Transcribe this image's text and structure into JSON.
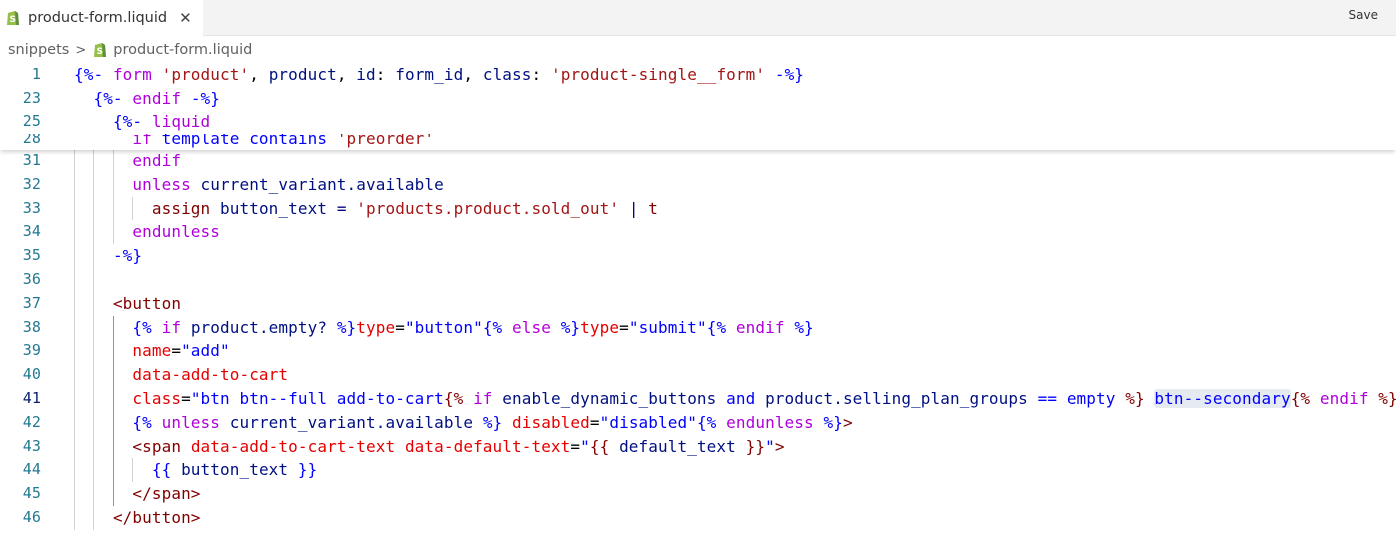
{
  "tab": {
    "title": "product-form.liquid",
    "close_icon": "close-icon",
    "file_icon": "shopify-icon"
  },
  "toolbar": {
    "save_label": "Save"
  },
  "breadcrumb": {
    "folder": "snippets",
    "file": "product-form.liquid"
  },
  "colors": {
    "brand_icon": "#95bf47",
    "line_number": "#237893",
    "selection_highlight": "#e5ebf1"
  },
  "editor": {
    "current_line": "41",
    "sticky": [
      {
        "num": "1",
        "tokens": [
          [
            "d",
            "{%-"
          ],
          [
            "p",
            " "
          ],
          [
            "k",
            "form"
          ],
          [
            "p",
            " "
          ],
          [
            "s",
            "'product'"
          ],
          [
            "p",
            ", "
          ],
          [
            "v",
            "product"
          ],
          [
            "p",
            ", "
          ],
          [
            "v",
            "id"
          ],
          [
            "p",
            ": "
          ],
          [
            "v",
            "form_id"
          ],
          [
            "p",
            ", "
          ],
          [
            "v",
            "class"
          ],
          [
            "p",
            ": "
          ],
          [
            "s",
            "'product-single__form'"
          ],
          [
            "p",
            " "
          ],
          [
            "d",
            "-%}"
          ]
        ]
      },
      {
        "num": "23",
        "tokens": [
          [
            "p",
            "  "
          ],
          [
            "d",
            "{%-"
          ],
          [
            "p",
            " "
          ],
          [
            "k",
            "endif"
          ],
          [
            "p",
            " "
          ],
          [
            "d",
            "-%}"
          ]
        ]
      },
      {
        "num": "25",
        "tokens": [
          [
            "p",
            "    "
          ],
          [
            "d",
            "{%-"
          ],
          [
            "p",
            " "
          ],
          [
            "k",
            "liquid"
          ]
        ]
      },
      {
        "num": "28",
        "tokens": [
          [
            "p",
            "      "
          ],
          [
            "k",
            "if"
          ],
          [
            "p",
            " "
          ],
          [
            "d",
            "template contains"
          ],
          [
            "p",
            " "
          ],
          [
            "s",
            "'preorder'"
          ]
        ]
      }
    ],
    "lines": [
      {
        "num": "31",
        "tokens": [
          [
            "p",
            "      "
          ],
          [
            "k",
            "endif"
          ]
        ]
      },
      {
        "num": "32",
        "tokens": [
          [
            "p",
            "      "
          ],
          [
            "k",
            "unless"
          ],
          [
            "p",
            " "
          ],
          [
            "v",
            "current_variant.available"
          ]
        ]
      },
      {
        "num": "33",
        "tokens": [
          [
            "p",
            "        "
          ],
          [
            "t",
            "assign"
          ],
          [
            "p",
            " "
          ],
          [
            "v",
            "button_text"
          ],
          [
            "p",
            " "
          ],
          [
            "o",
            "="
          ],
          [
            "p",
            " "
          ],
          [
            "s",
            "'products.product.sold_out'"
          ],
          [
            "p",
            " "
          ],
          [
            "o",
            "|"
          ],
          [
            "p",
            " "
          ],
          [
            "t",
            "t"
          ]
        ]
      },
      {
        "num": "34",
        "tokens": [
          [
            "p",
            "      "
          ],
          [
            "k",
            "endunless"
          ]
        ]
      },
      {
        "num": "35",
        "tokens": [
          [
            "p",
            "    "
          ],
          [
            "d",
            "-%}"
          ]
        ]
      },
      {
        "num": "36",
        "tokens": []
      },
      {
        "num": "37",
        "tokens": [
          [
            "p",
            "    "
          ],
          [
            "t",
            "<button"
          ]
        ]
      },
      {
        "num": "38",
        "tokens": [
          [
            "p",
            "      "
          ],
          [
            "d",
            "{%"
          ],
          [
            "p",
            " "
          ],
          [
            "k",
            "if"
          ],
          [
            "p",
            " "
          ],
          [
            "v",
            "product.empty?"
          ],
          [
            "p",
            " "
          ],
          [
            "d",
            "%}"
          ],
          [
            "a",
            "type"
          ],
          [
            "p",
            "="
          ],
          [
            "av",
            "\"button\""
          ],
          [
            "d",
            "{%"
          ],
          [
            "p",
            " "
          ],
          [
            "k",
            "else"
          ],
          [
            "p",
            " "
          ],
          [
            "d",
            "%}"
          ],
          [
            "a",
            "type"
          ],
          [
            "p",
            "="
          ],
          [
            "av",
            "\"submit\""
          ],
          [
            "d",
            "{%"
          ],
          [
            "p",
            " "
          ],
          [
            "k",
            "endif"
          ],
          [
            "p",
            " "
          ],
          [
            "d",
            "%}"
          ]
        ]
      },
      {
        "num": "39",
        "tokens": [
          [
            "p",
            "      "
          ],
          [
            "a",
            "name"
          ],
          [
            "p",
            "="
          ],
          [
            "av",
            "\"add\""
          ]
        ]
      },
      {
        "num": "40",
        "tokens": [
          [
            "p",
            "      "
          ],
          [
            "a",
            "data-add-to-cart"
          ]
        ]
      },
      {
        "num": "41",
        "tokens": [
          [
            "p",
            "      "
          ],
          [
            "a",
            "class"
          ],
          [
            "p",
            "="
          ],
          [
            "av",
            "\"btn btn--full add-to-cart"
          ],
          [
            "m",
            "{%"
          ],
          [
            "p",
            " "
          ],
          [
            "k",
            "if"
          ],
          [
            "p",
            " "
          ],
          [
            "v",
            "enable_dynamic_buttons"
          ],
          [
            "p",
            " "
          ],
          [
            "d",
            "and"
          ],
          [
            "p",
            " "
          ],
          [
            "v",
            "product.selling_plan_groups"
          ],
          [
            "p",
            " "
          ],
          [
            "d",
            "=="
          ],
          [
            "p",
            " "
          ],
          [
            "d",
            "empty"
          ],
          [
            "p",
            " "
          ],
          [
            "m",
            "%}"
          ],
          [
            "av",
            " "
          ],
          [
            "av hl",
            "btn--secondary"
          ],
          [
            "m",
            "{%"
          ],
          [
            "p",
            " "
          ],
          [
            "k",
            "endif"
          ],
          [
            "p",
            " "
          ],
          [
            "m",
            "%}"
          ],
          [
            "m",
            "\""
          ]
        ]
      },
      {
        "num": "42",
        "tokens": [
          [
            "p",
            "      "
          ],
          [
            "d",
            "{%"
          ],
          [
            "p",
            " "
          ],
          [
            "k",
            "unless"
          ],
          [
            "p",
            " "
          ],
          [
            "v",
            "current_variant.available"
          ],
          [
            "p",
            " "
          ],
          [
            "d",
            "%}"
          ],
          [
            "p",
            " "
          ],
          [
            "a",
            "disabled"
          ],
          [
            "p",
            "="
          ],
          [
            "av",
            "\"disabled\""
          ],
          [
            "d",
            "{%"
          ],
          [
            "p",
            " "
          ],
          [
            "k",
            "endunless"
          ],
          [
            "p",
            " "
          ],
          [
            "d",
            "%}"
          ],
          [
            "t",
            ">"
          ]
        ]
      },
      {
        "num": "43",
        "tokens": [
          [
            "p",
            "      "
          ],
          [
            "t",
            "<span"
          ],
          [
            "p",
            " "
          ],
          [
            "a",
            "data-add-to-cart-text"
          ],
          [
            "p",
            " "
          ],
          [
            "a",
            "data-default-text"
          ],
          [
            "p",
            "="
          ],
          [
            "av",
            "\""
          ],
          [
            "m",
            "{{"
          ],
          [
            "p",
            " "
          ],
          [
            "v",
            "default_text"
          ],
          [
            "p",
            " "
          ],
          [
            "m",
            "}}"
          ],
          [
            "av",
            "\""
          ],
          [
            "t",
            ">"
          ]
        ]
      },
      {
        "num": "44",
        "tokens": [
          [
            "p",
            "        "
          ],
          [
            "d",
            "{{"
          ],
          [
            "p",
            " "
          ],
          [
            "v",
            "button_text"
          ],
          [
            "p",
            " "
          ],
          [
            "d",
            "}}"
          ]
        ]
      },
      {
        "num": "45",
        "tokens": [
          [
            "p",
            "      "
          ],
          [
            "t",
            "</span>"
          ]
        ]
      },
      {
        "num": "46",
        "tokens": [
          [
            "p",
            "    "
          ],
          [
            "t",
            "</button>"
          ]
        ]
      }
    ]
  }
}
